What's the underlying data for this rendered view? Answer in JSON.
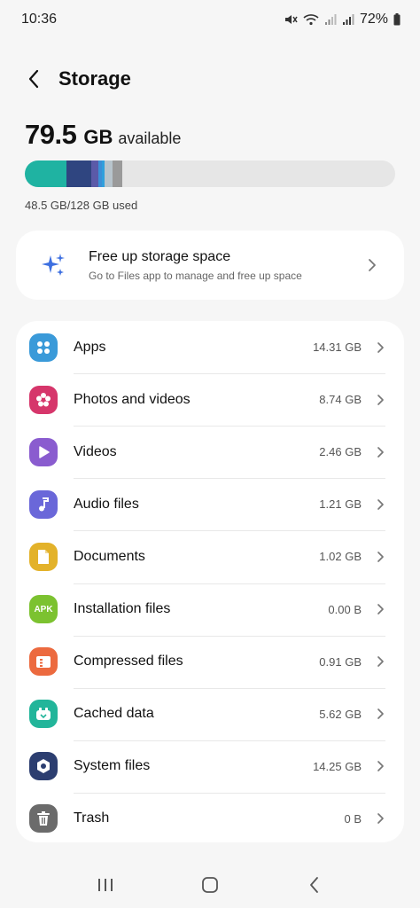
{
  "status": {
    "time": "10:36",
    "battery": "72%"
  },
  "header": {
    "title": "Storage"
  },
  "summary": {
    "available_value": "79.5",
    "available_unit": "GB",
    "available_label": "available",
    "used_text": "48.5 GB/128 GB used",
    "bar_segments": [
      {
        "name": "apps",
        "color": "#1fb3a2",
        "fraction": 0.1118
      },
      {
        "name": "photos",
        "color": "#2f4580",
        "fraction": 0.068
      },
      {
        "name": "videos",
        "color": "#5b5aa8",
        "fraction": 0.0192
      },
      {
        "name": "audio",
        "color": "#3b8fd6",
        "fraction": 0.0095
      },
      {
        "name": "documents",
        "color": "#2f9fdc",
        "fraction": 0.008
      },
      {
        "name": "cached",
        "color": "#b8c4cc",
        "fraction": 0.0215
      },
      {
        "name": "system",
        "color": "#9a9a9a",
        "fraction": 0.025
      }
    ]
  },
  "free_up": {
    "title": "Free up storage space",
    "subtitle": "Go to Files app to manage and free up space",
    "icon": "sparkle-icon",
    "icon_color": "#3d6fe0"
  },
  "categories": [
    {
      "id": "apps",
      "label": "Apps",
      "size": "14.31 GB",
      "icon": "apps-icon",
      "color": "#3a9ad9"
    },
    {
      "id": "photos-videos",
      "label": "Photos and videos",
      "size": "8.74 GB",
      "icon": "flower-icon",
      "color": "#d6366b"
    },
    {
      "id": "videos",
      "label": "Videos",
      "size": "2.46 GB",
      "icon": "play-icon",
      "color": "#8a5ccf"
    },
    {
      "id": "audio-files",
      "label": "Audio files",
      "size": "1.21 GB",
      "icon": "music-note-icon",
      "color": "#6a67d9"
    },
    {
      "id": "documents",
      "label": "Documents",
      "size": "1.02 GB",
      "icon": "document-icon",
      "color": "#e3b22a"
    },
    {
      "id": "installation-files",
      "label": "Installation files",
      "size": "0.00 B",
      "icon": "apk-icon",
      "icon_text": "APK",
      "color": "#7cc230"
    },
    {
      "id": "compressed-files",
      "label": "Compressed files",
      "size": "0.91 GB",
      "icon": "archive-icon",
      "color": "#ec6a3f"
    },
    {
      "id": "cached-data",
      "label": "Cached data",
      "size": "5.62 GB",
      "icon": "cache-icon",
      "color": "#22b59a"
    },
    {
      "id": "system-files",
      "label": "System files",
      "size": "14.25 GB",
      "icon": "system-icon",
      "color": "#2c3e70"
    },
    {
      "id": "trash",
      "label": "Trash",
      "size": "0 B",
      "icon": "trash-icon",
      "color": "#6b6b6b"
    }
  ]
}
